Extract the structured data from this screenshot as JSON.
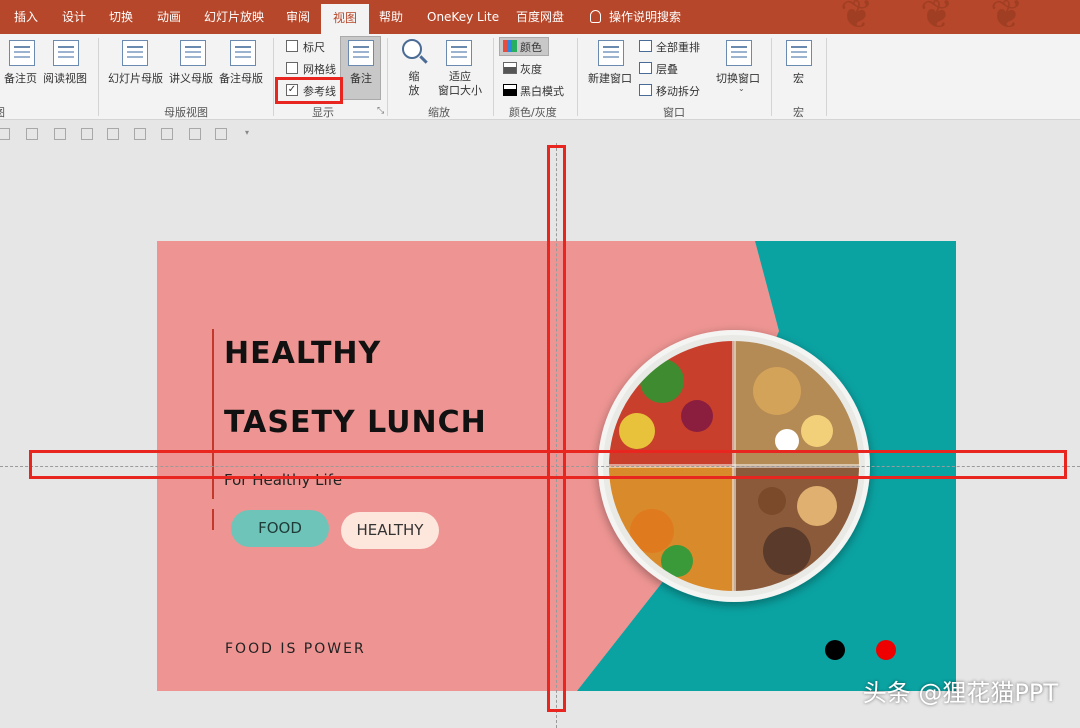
{
  "tabs": [
    "插入",
    "设计",
    "切换",
    "动画",
    "幻灯片放映",
    "审阅",
    "视图",
    "帮助",
    "OneKey Lite",
    "百度网盘",
    "操作说明搜索"
  ],
  "active_tab_index": 6,
  "ribbon": {
    "views": {
      "notes_page": "备注页",
      "reading_view": "阅读视图",
      "group_label": "图"
    },
    "master": {
      "slide_master": "幻灯片母版",
      "handout_master": "讲义母版",
      "notes_master": "备注母版",
      "group_label": "母版视图"
    },
    "show": {
      "ruler": "标尺",
      "gridlines": "网格线",
      "guides": "参考线",
      "notes": "备注",
      "group_label": "显示",
      "ruler_checked": false,
      "gridlines_checked": false,
      "guides_checked": true
    },
    "zoom": {
      "zoom_line1": "缩",
      "zoom_line2": "放",
      "fit_line1": "适应",
      "fit_line2": "窗口大小",
      "group_label": "缩放"
    },
    "color": {
      "color": "颜色",
      "grayscale": "灰度",
      "bw": "黑白模式",
      "group_label": "颜色/灰度"
    },
    "window": {
      "new_window": "新建窗口",
      "arrange_all": "全部重排",
      "cascade": "层叠",
      "move_split": "移动拆分",
      "switch_windows": "切换窗口",
      "group_label": "窗口"
    },
    "macros": {
      "macro": "宏",
      "group_label": "宏"
    }
  },
  "slide": {
    "title_line1": "HEALTHY",
    "title_line2": "TASETY LUNCH",
    "subtitle": "For Healthy Life",
    "pill1": "FOOD",
    "pill2": "HEALTHY",
    "footer": "FOOD IS POWER",
    "colors": {
      "background": "#ee9593",
      "teal": "#0aa3a2",
      "pill1": "#6ec4b8",
      "pill2": "#fde6dc",
      "dot1": "#000000",
      "dot2": "#ee0000"
    }
  },
  "watermark": "头条 @狸花猫PPT"
}
